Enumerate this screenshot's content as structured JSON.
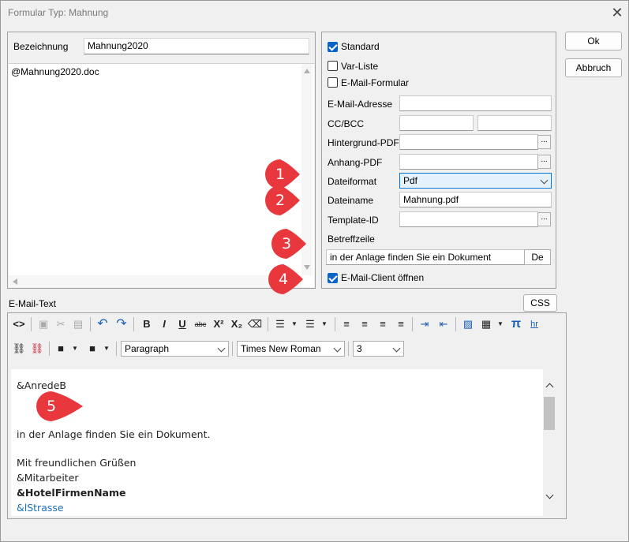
{
  "window": {
    "title": "Formular Typ: Mahnung",
    "close_glyph": "✕"
  },
  "left": {
    "bezeichnung_label": "Bezeichnung",
    "bezeichnung_value": "Mahnung2020",
    "textarea_value": "@Mahnung2020.doc"
  },
  "right": {
    "standard_label": "Standard",
    "standard_checked": true,
    "varliste_label": "Var-Liste",
    "varliste_checked": false,
    "emailformular_label": "E-Mail-Formular",
    "emailformular_checked": false,
    "emailadresse_label": "E-Mail-Adresse",
    "emailadresse_value": "",
    "ccbcc_label": "CC/BCC",
    "cc_value": "",
    "bcc_value": "",
    "hintergrund_label": "Hintergrund-PDF",
    "hintergrund_value": "",
    "anhang_label": "Anhang-PDF",
    "anhang_value": "",
    "dateiformat_label": "Dateiformat",
    "dateiformat_value": "Pdf",
    "dateiname_label": "Dateiname",
    "dateiname_value": "Mahnung.pdf",
    "templateid_label": "Template-ID",
    "templateid_value": "",
    "betreffzeile_label": "Betreffzeile",
    "betreffzeile_value": "in der Anlage finden Sie ein Dokument",
    "lang_button": "De",
    "mailclient_label": "E-Mail-Client öffnen",
    "mailclient_checked": true,
    "ellipsis": "..."
  },
  "buttons": {
    "ok": "Ok",
    "abbruch": "Abbruch",
    "css": "CSS"
  },
  "email": {
    "section_label": "E-Mail-Text",
    "format_select": "Paragraph",
    "font_select": "Times New Roman",
    "size_select": "3",
    "lines": {
      "l1": "&AnredeB",
      "l2": "in der Anlage finden Sie ein Dokument.",
      "l3": "Mit freundlichen Grüßen",
      "l4": "&Mitarbeiter",
      "l5": "&HotelFirmenName",
      "l6": "&lStrasse"
    }
  },
  "annotations": {
    "b1": "1",
    "b2": "2",
    "b3": "3",
    "b4": "4",
    "b5": "5",
    "color": "#e8383d"
  },
  "toolbar": {
    "bold": "B",
    "italic": "I",
    "underline": "U",
    "strike": "abc",
    "sup": "X²",
    "sub": "X₂",
    "pi": "π",
    "hr": "hr"
  }
}
